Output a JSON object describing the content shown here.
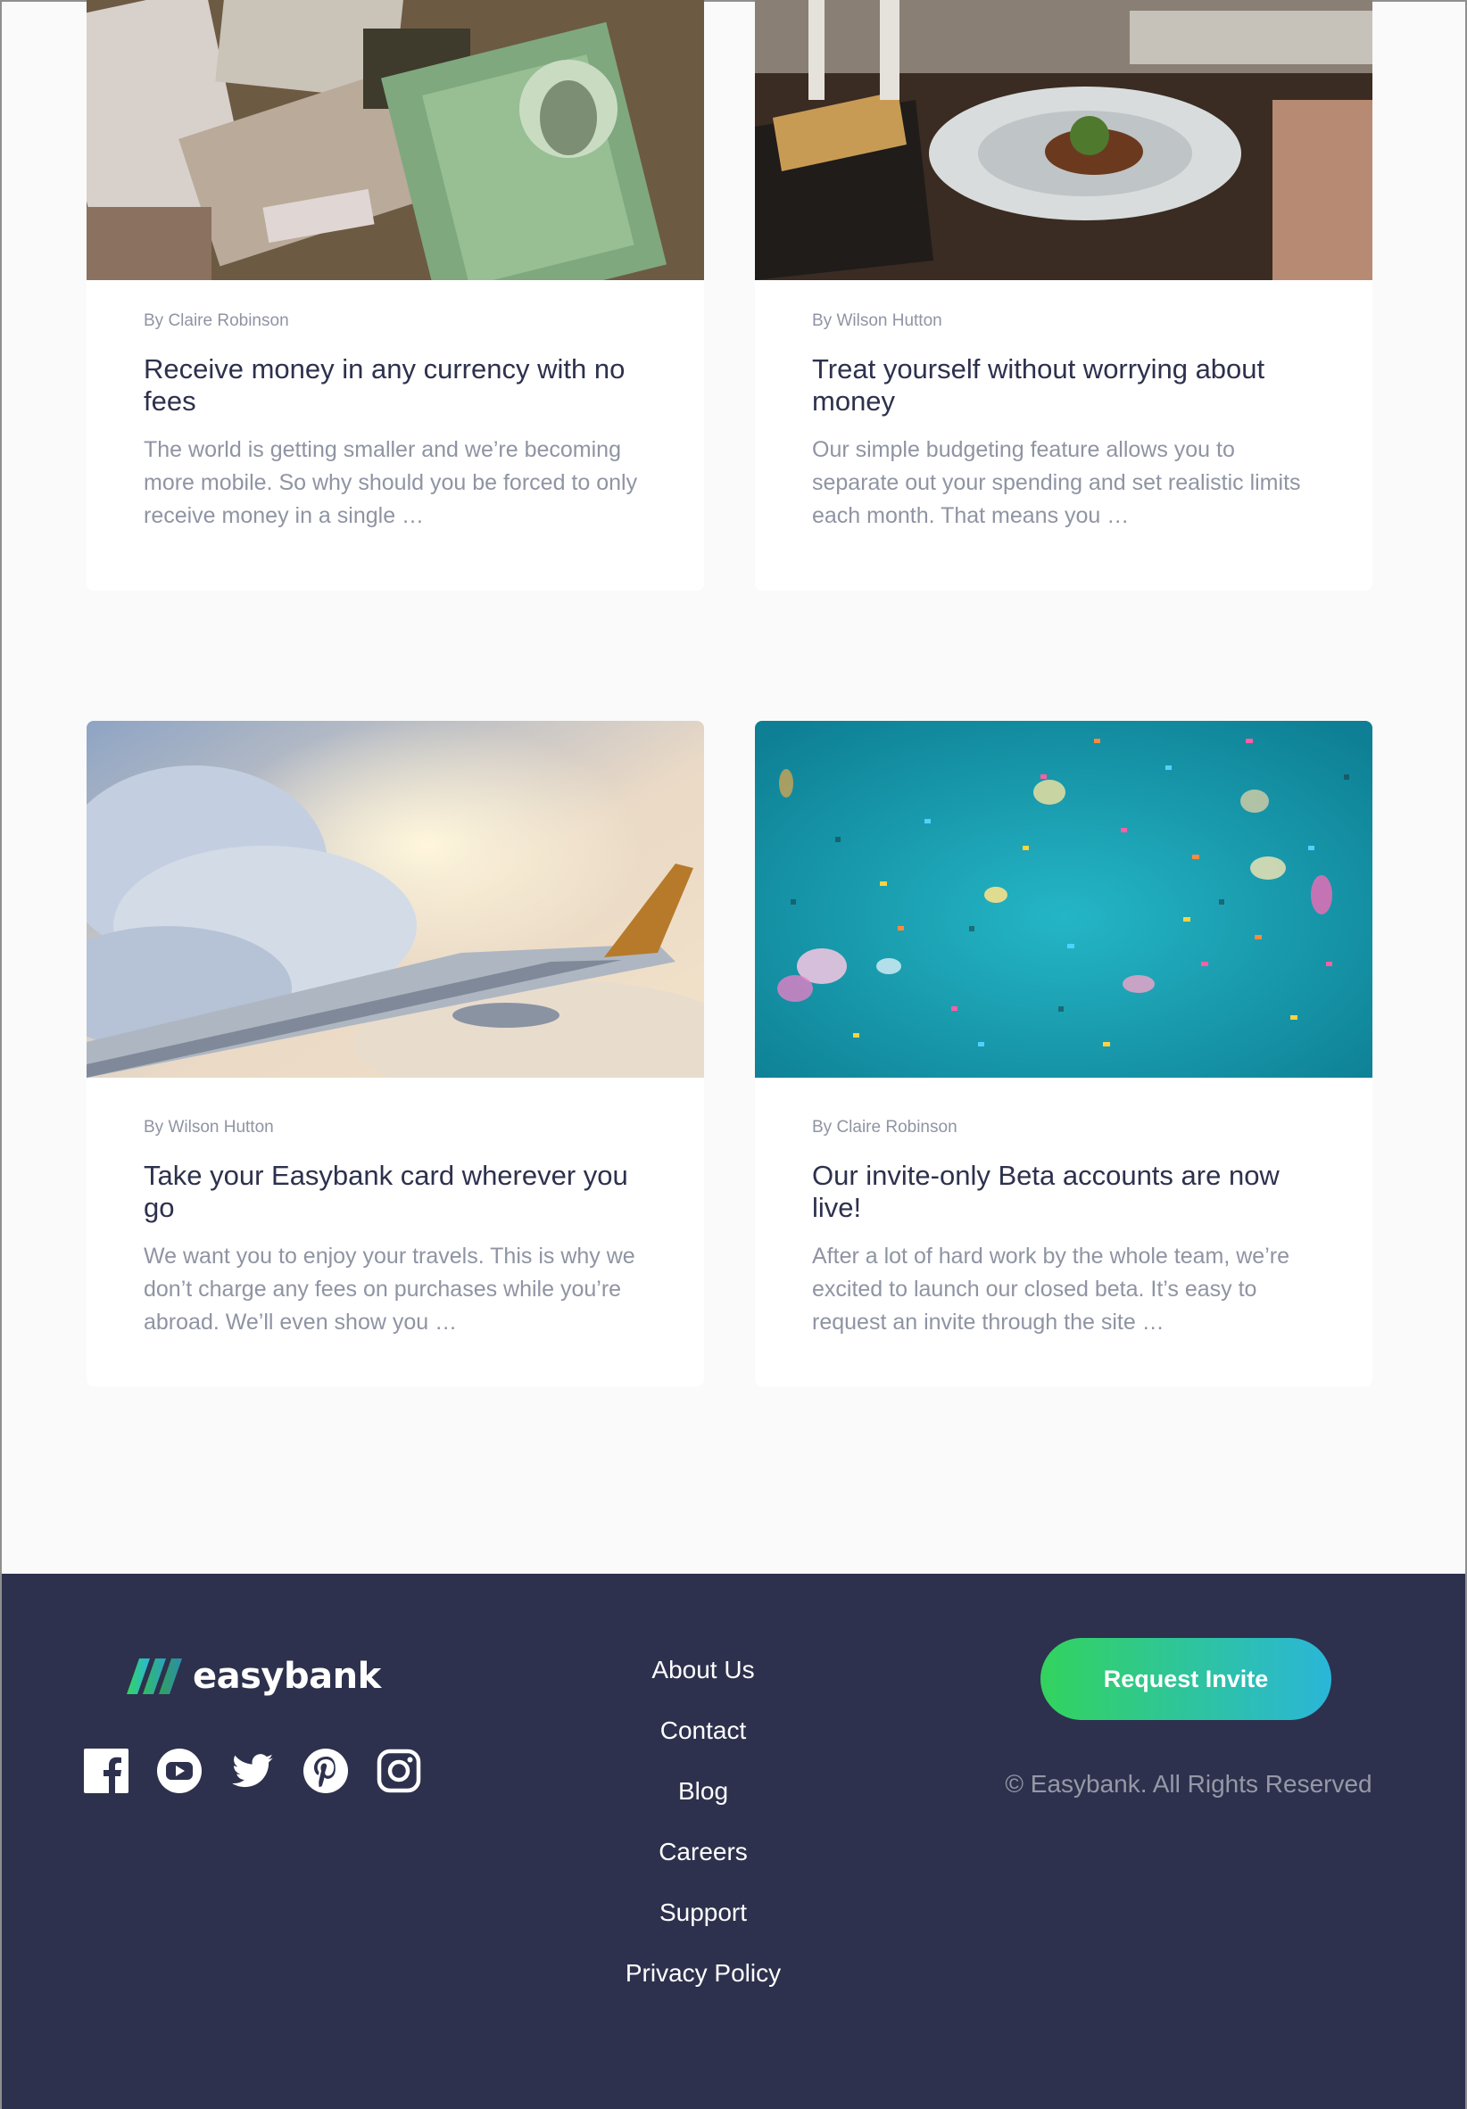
{
  "articles": [
    {
      "image": "currency-notes-photo",
      "author": "By Claire Robinson",
      "title": "Receive money in any currency with no fees",
      "excerpt": "The world is getting smaller and we’re becoming more mobile. So why should you be forced to only receive money in a single …"
    },
    {
      "image": "restaurant-dinner-photo",
      "author": "By Wilson Hutton",
      "title": "Treat yourself without worrying about money",
      "excerpt": "Our simple budgeting feature allows you to separate out your spending and set realistic limits each month. That means you …"
    },
    {
      "image": "airplane-wing-photo",
      "author": "By Wilson Hutton",
      "title": "Take your Easybank card wherever you go",
      "excerpt": "We want you to enjoy your travels. This is why we don’t charge any fees on purchases while you’re abroad. We’ll even show you …"
    },
    {
      "image": "confetti-photo",
      "author": "By Claire Robinson",
      "title": "Our invite-only Beta accounts are now live!",
      "excerpt": "After a lot of hard work by the whole team, we’re excited to launch our closed beta. It’s easy to request an invite through the site …"
    }
  ],
  "footer": {
    "logo_text": "easybank",
    "social_icons": [
      "facebook-icon",
      "youtube-icon",
      "twitter-icon",
      "pinterest-icon",
      "instagram-icon"
    ],
    "links": [
      "About Us",
      "Contact",
      "Blog",
      "Careers",
      "Support",
      "Privacy Policy"
    ],
    "cta_label": "Request Invite",
    "copyright": "© Easybank. All Rights Reserved"
  },
  "colors": {
    "page_background": "#fafafa",
    "footer_background": "#2d314d",
    "title_text": "#2d314d",
    "muted_text": "#8f94a3",
    "gradient_start": "#33d35e",
    "gradient_end": "#2ab6d9"
  }
}
